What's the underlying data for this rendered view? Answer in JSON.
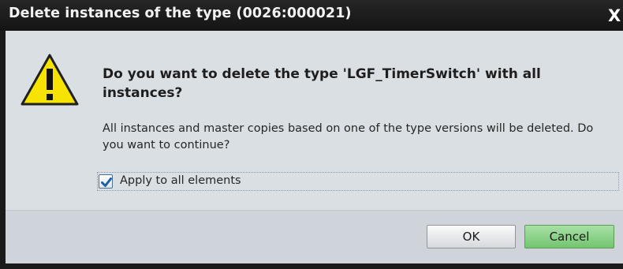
{
  "window": {
    "title": "Delete instances of the type (0026:000021)",
    "close_glyph": "X",
    "close_icon": "close-icon"
  },
  "message": {
    "icon": "warning-icon",
    "headline": "Do you want to delete the type 'LGF_TimerSwitch' with all instances?",
    "detail": "All instances and master copies based on one of the type versions will be deleted. Do you want to continue?"
  },
  "option": {
    "label": "Apply to all elements",
    "checked": true
  },
  "buttons": {
    "ok_label": "OK",
    "cancel_label": "Cancel"
  },
  "colors": {
    "warning_fill": "#f6e400",
    "cancel_accent": "#73c56f",
    "checkbox_check": "#1d5fa8"
  }
}
